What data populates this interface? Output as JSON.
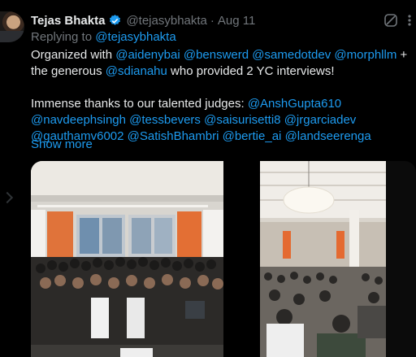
{
  "author": {
    "name": "Tejas Bhakta",
    "handle": "@tejasybhakta",
    "separator": "·",
    "date": "Aug 11"
  },
  "reply_line": {
    "prefix": "Replying to",
    "mention": "@tejasybhakta"
  },
  "body": {
    "line1": {
      "t1": "Organized with ",
      "m1": "@aidenybai",
      "m2": "@benswerd",
      "m3": "@samedotdev",
      "m4": "@morphllm",
      "t2": " + the generous ",
      "m5": "@sdianahu",
      "t3": " who provided 2 YC interviews!"
    },
    "line2": {
      "t1": "Immense thanks to our talented judges: ",
      "m1": "@AnshGupta610",
      "m2": "@navdeephsingh",
      "m3": "@tessbevers",
      "m4": "@saisurisetti8",
      "m5": "@jrgarciadev",
      "m6": "@gauthamv6002",
      "m7": "@SatishBhambri",
      "m8": "@bertie_ai",
      "m9": "@landseerenga"
    }
  },
  "show_more": "Show more",
  "colors": {
    "background": "#000000",
    "text": "#e7e9ea",
    "muted": "#71767b",
    "link": "#1d9bf0",
    "verified": "#1d9bf0"
  },
  "icons": [
    "verified-badge-icon",
    "grok-icon",
    "more-options-icon",
    "chevron-icon"
  ],
  "media": {
    "count": 2,
    "photo1": "group-photo",
    "photo2": "hackathon-room-photo"
  }
}
